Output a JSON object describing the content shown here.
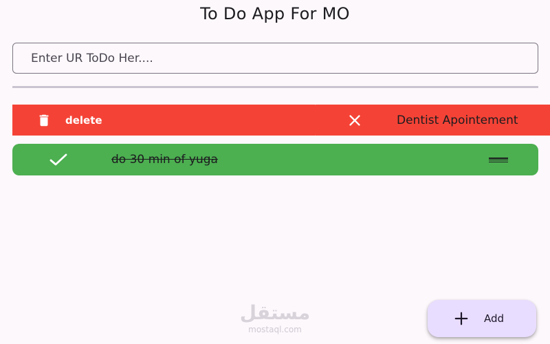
{
  "app": {
    "title": "To Do App For MO"
  },
  "input": {
    "placeholder": "Enter UR ToDo Her...."
  },
  "swipe_action": {
    "label": "delete",
    "icon": "trash-icon",
    "color": "#f44336"
  },
  "todos": [
    {
      "title": "Dentist Apointement",
      "completed": false,
      "icon": "close-icon",
      "color": "#f44336"
    },
    {
      "title": "do 30 min of yuga",
      "completed": true,
      "icon": "check-icon",
      "color": "#4caf50"
    }
  ],
  "fab": {
    "label": "Add",
    "icon": "plus-icon",
    "color": "#e9ddff"
  },
  "watermark": {
    "arabic": "مستقل",
    "latin": "mostaql.com"
  }
}
